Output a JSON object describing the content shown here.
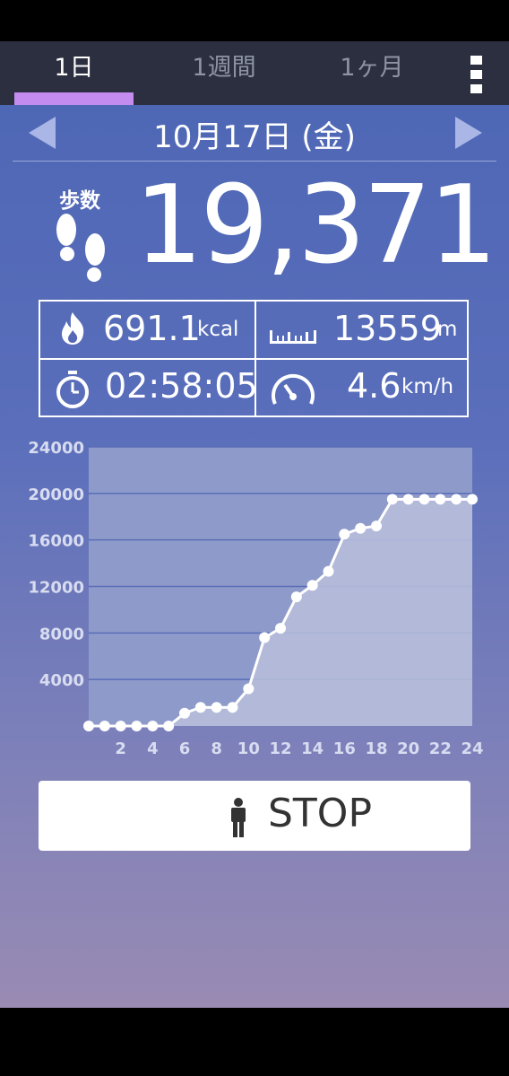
{
  "tabs": [
    {
      "label": "1日",
      "active": true
    },
    {
      "label": "1週間",
      "active": false
    },
    {
      "label": "1ヶ月",
      "active": false
    }
  ],
  "date": "10月17日 (金)",
  "steps": {
    "label": "歩数",
    "value": "19,371"
  },
  "stats": {
    "calories": {
      "value": "691.1",
      "unit": "kcal",
      "icon": "flame-icon"
    },
    "distance": {
      "value": "13559",
      "unit": "m",
      "icon": "ruler-icon"
    },
    "time": {
      "value": "02:58:05",
      "icon": "stopwatch-icon"
    },
    "speed": {
      "value": "4.6",
      "unit": "km/h",
      "icon": "speedometer-icon"
    }
  },
  "chart_data": {
    "type": "line",
    "x": [
      0,
      1,
      2,
      3,
      4,
      5,
      6,
      7,
      8,
      9,
      10,
      11,
      12,
      13,
      14,
      15,
      16,
      17,
      18,
      19,
      20,
      21,
      22,
      23,
      24
    ],
    "values": [
      0,
      0,
      0,
      0,
      0,
      0,
      1100,
      1600,
      1600,
      1600,
      3200,
      7600,
      8400,
      11100,
      12100,
      13300,
      16500,
      17000,
      17200,
      19500,
      19500,
      19500,
      19500,
      19500,
      19500
    ],
    "xticks": [
      "2",
      "4",
      "6",
      "8",
      "10",
      "12",
      "14",
      "16",
      "18",
      "20",
      "22",
      "24"
    ],
    "yticks": [
      "4000",
      "8000",
      "12000",
      "16000",
      "20000",
      "24000"
    ],
    "ylim": [
      0,
      24000
    ],
    "xlim": [
      0,
      24
    ],
    "grid": true
  },
  "stop_button": {
    "label": "STOP",
    "icon": "person-icon"
  }
}
